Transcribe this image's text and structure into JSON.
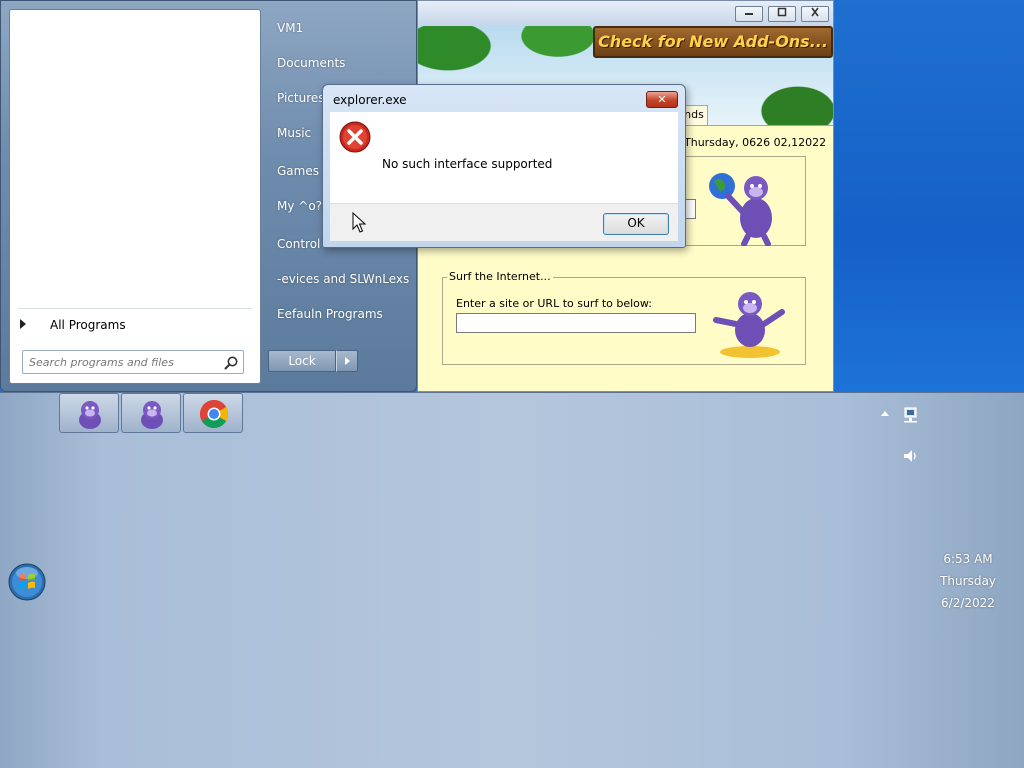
{
  "bonzi": {
    "banner_text": "Check for New Add-Ons...",
    "tab_fragment": "nds",
    "date_text": "Thursday, 0626 02,12022",
    "surf_group_title": "Surf the Internet...",
    "surf_prompt": "Enter a site or URL to surf to below:",
    "surf_value": ""
  },
  "start_menu": {
    "all_programs": "All Programs",
    "search_placeholder": "Search programs and files",
    "right_items": [
      "VM1",
      "Documents",
      "Pictures",
      "Music",
      "Games",
      "My ^o?p",
      "Control I",
      "-evices and SLWnLexs",
      "Eefauln Programs"
    ],
    "lock_label": "Lock"
  },
  "dialog": {
    "title": "explorer.exe",
    "close_glyph": "✕",
    "message": "No such interface supported",
    "ok_label": "OK"
  },
  "taskbar": {
    "buttons": [
      {
        "icon": "bonzi-buddy-icon"
      },
      {
        "icon": "bonzi-buddy-icon"
      },
      {
        "icon": "chrome-icon"
      }
    ],
    "clock": {
      "time": "6:53 AM",
      "day": "Thursday",
      "date": "6/2/2022"
    }
  },
  "icons": {
    "error": "error-icon",
    "search": "search-icon",
    "network": "network-icon",
    "volume": "volume-icon",
    "start": "windows-start-orb-icon"
  },
  "colors": {
    "desktop_blue": "#1565c8",
    "start_menu_pane": "#6e8cad",
    "dialog_close_red": "#c4432b",
    "bonzi_panel_yellow": "#fffcc8",
    "bonzi_purple": "#6e4fb5"
  }
}
